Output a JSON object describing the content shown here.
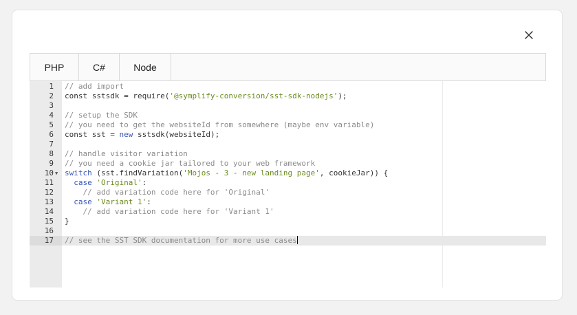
{
  "colors": {
    "comment": "#8a8a8a",
    "string": "#6b8a1e",
    "keyword": "#3b56b8",
    "plain": "#333333"
  },
  "icons": {
    "close": "close-icon",
    "fold": "fold-arrow-icon"
  },
  "tabs": [
    {
      "label": "PHP"
    },
    {
      "label": "C#"
    },
    {
      "label": "Node"
    }
  ],
  "editor": {
    "active_line": 17,
    "fold_lines": [
      10
    ],
    "lines": [
      {
        "n": "1",
        "tokens": [
          {
            "t": "comment",
            "v": "// add import"
          }
        ]
      },
      {
        "n": "2",
        "tokens": [
          {
            "t": "plain",
            "v": "const sstsdk = require("
          },
          {
            "t": "string",
            "v": "'@symplify-conversion/sst-sdk-nodejs'"
          },
          {
            "t": "plain",
            "v": ");"
          }
        ]
      },
      {
        "n": "3",
        "tokens": []
      },
      {
        "n": "4",
        "tokens": [
          {
            "t": "comment",
            "v": "// setup the SDK"
          }
        ]
      },
      {
        "n": "5",
        "tokens": [
          {
            "t": "comment",
            "v": "// you need to get the websiteId from somewhere (maybe env variable)"
          }
        ]
      },
      {
        "n": "6",
        "tokens": [
          {
            "t": "plain",
            "v": "const sst = "
          },
          {
            "t": "keyword",
            "v": "new"
          },
          {
            "t": "plain",
            "v": " sstsdk(websiteId);"
          }
        ]
      },
      {
        "n": "7",
        "tokens": []
      },
      {
        "n": "8",
        "tokens": [
          {
            "t": "comment",
            "v": "// handle visitor variation"
          }
        ]
      },
      {
        "n": "9",
        "tokens": [
          {
            "t": "comment",
            "v": "// you need a cookie jar tailored to your web framework"
          }
        ]
      },
      {
        "n": "10",
        "tokens": [
          {
            "t": "keyword",
            "v": "switch"
          },
          {
            "t": "plain",
            "v": " (sst.findVariation("
          },
          {
            "t": "string",
            "v": "'Mojos - 3 - new landing page'"
          },
          {
            "t": "plain",
            "v": ", cookieJar)) {"
          }
        ]
      },
      {
        "n": "11",
        "tokens": [
          {
            "t": "plain",
            "v": "  "
          },
          {
            "t": "keyword",
            "v": "case"
          },
          {
            "t": "plain",
            "v": " "
          },
          {
            "t": "string",
            "v": "'Original'"
          },
          {
            "t": "plain",
            "v": ":"
          }
        ]
      },
      {
        "n": "12",
        "tokens": [
          {
            "t": "plain",
            "v": "    "
          },
          {
            "t": "comment",
            "v": "// add variation code here for 'Original'"
          }
        ]
      },
      {
        "n": "13",
        "tokens": [
          {
            "t": "plain",
            "v": "  "
          },
          {
            "t": "keyword",
            "v": "case"
          },
          {
            "t": "plain",
            "v": " "
          },
          {
            "t": "string",
            "v": "'Variant 1'"
          },
          {
            "t": "plain",
            "v": ":"
          }
        ]
      },
      {
        "n": "14",
        "tokens": [
          {
            "t": "plain",
            "v": "    "
          },
          {
            "t": "comment",
            "v": "// add variation code here for 'Variant 1'"
          }
        ]
      },
      {
        "n": "15",
        "tokens": [
          {
            "t": "plain",
            "v": "}"
          }
        ]
      },
      {
        "n": "16",
        "tokens": []
      },
      {
        "n": "17",
        "tokens": [
          {
            "t": "comment",
            "v": "// see the SST SDK documentation for more use cases"
          }
        ]
      }
    ]
  }
}
